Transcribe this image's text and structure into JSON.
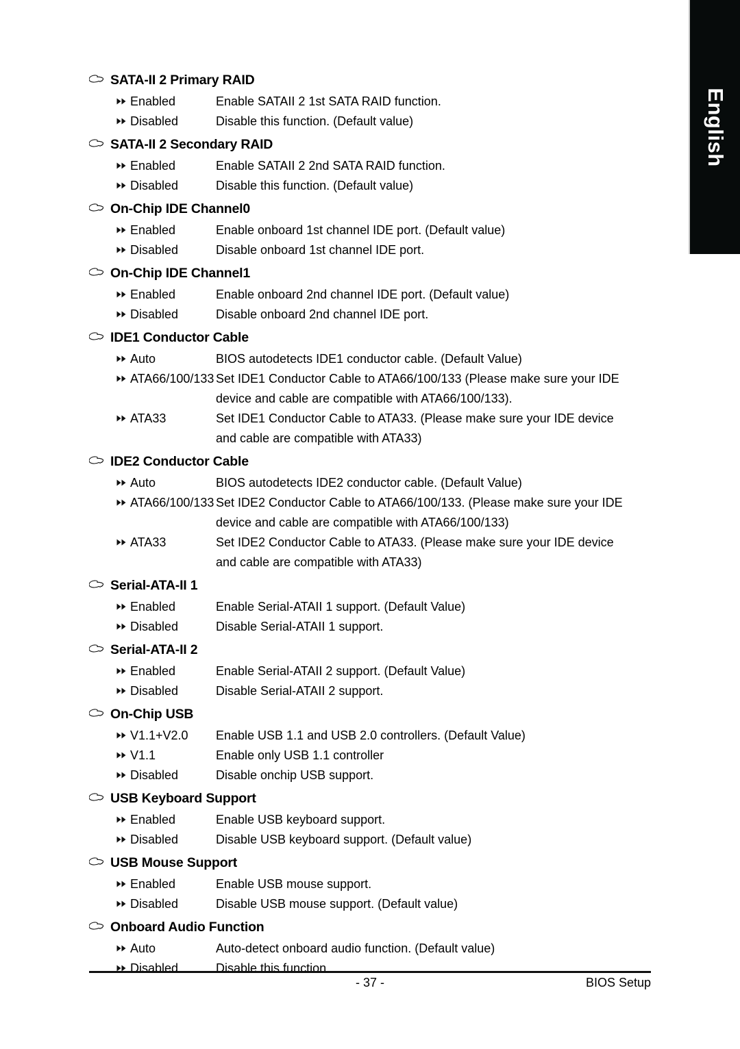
{
  "language_tab": {
    "label": "English"
  },
  "icons": {
    "heading_marker": "pointing-hand-icon",
    "option_marker": "double-triangle-icon"
  },
  "footer": {
    "page_number": "- 37 -",
    "right_label": "BIOS Setup"
  },
  "sections": [
    {
      "title": "SATA-II 2 Primary RAID",
      "options": [
        {
          "label": "Enabled",
          "desc": "Enable SATAII 2 1st SATA RAID function."
        },
        {
          "label": "Disabled",
          "desc": "Disable this function. (Default value)"
        }
      ]
    },
    {
      "title": "SATA-II 2 Secondary RAID",
      "options": [
        {
          "label": "Enabled",
          "desc": "Enable SATAII 2 2nd SATA RAID function."
        },
        {
          "label": "Disabled",
          "desc": "Disable this function. (Default value)"
        }
      ]
    },
    {
      "title": "On-Chip IDE Channel0",
      "options": [
        {
          "label": "Enabled",
          "desc": "Enable onboard 1st channel IDE port. (Default value)"
        },
        {
          "label": "Disabled",
          "desc": "Disable onboard 1st channel IDE port."
        }
      ]
    },
    {
      "title": "On-Chip IDE Channel1",
      "options": [
        {
          "label": "Enabled",
          "desc": "Enable onboard 2nd channel IDE port. (Default value)"
        },
        {
          "label": "Disabled",
          "desc": "Disable onboard 2nd channel IDE port."
        }
      ]
    },
    {
      "title": "IDE1 Conductor Cable",
      "options": [
        {
          "label": "Auto",
          "desc": "BIOS autodetects IDE1 conductor cable. (Default Value)"
        },
        {
          "label": "ATA66/100/133",
          "desc": "Set IDE1 Conductor Cable to ATA66/100/133 (Please make sure your IDE",
          "desc2": "device and cable are compatible with ATA66/100/133)."
        },
        {
          "label": "ATA33",
          "desc": "Set IDE1 Conductor Cable to ATA33. (Please make sure your IDE device",
          "desc2": "and cable are compatible with ATA33)"
        }
      ]
    },
    {
      "title": "IDE2 Conductor Cable",
      "options": [
        {
          "label": "Auto",
          "desc": "BIOS autodetects IDE2 conductor cable. (Default Value)"
        },
        {
          "label": "ATA66/100/133",
          "desc": "Set IDE2 Conductor Cable to ATA66/100/133. (Please make sure your IDE",
          "desc2": "device and cable are compatible with ATA66/100/133)"
        },
        {
          "label": "ATA33",
          "desc": "Set IDE2 Conductor Cable to ATA33. (Please make sure your IDE device",
          "desc2": "and cable are compatible with ATA33)"
        }
      ]
    },
    {
      "title": "Serial-ATA-II 1",
      "options": [
        {
          "label": "Enabled",
          "desc": "Enable Serial-ATAII 1 support. (Default Value)"
        },
        {
          "label": "Disabled",
          "desc": "Disable Serial-ATAII 1 support."
        }
      ]
    },
    {
      "title": "Serial-ATA-II 2",
      "options": [
        {
          "label": "Enabled",
          "desc": "Enable Serial-ATAII 2 support. (Default Value)"
        },
        {
          "label": "Disabled",
          "desc": "Disable Serial-ATAII 2 support."
        }
      ]
    },
    {
      "title": "On-Chip USB",
      "options": [
        {
          "label": "V1.1+V2.0",
          "desc": "Enable USB 1.1 and USB 2.0 controllers. (Default Value)"
        },
        {
          "label": "V1.1",
          "desc": "Enable only USB 1.1 controller"
        },
        {
          "label": "Disabled",
          "desc": "Disable onchip USB support."
        }
      ]
    },
    {
      "title": "USB Keyboard Support",
      "options": [
        {
          "label": "Enabled",
          "desc": "Enable USB keyboard support."
        },
        {
          "label": "Disabled",
          "desc": "Disable USB keyboard support. (Default value)"
        }
      ]
    },
    {
      "title": "USB Mouse Support",
      "options": [
        {
          "label": "Enabled",
          "desc": "Enable USB mouse support."
        },
        {
          "label": "Disabled",
          "desc": "Disable USB mouse support. (Default value)"
        }
      ]
    },
    {
      "title": "Onboard Audio Function",
      "options": [
        {
          "label": "Auto",
          "desc": "Auto-detect onboard audio function. (Default value)"
        },
        {
          "label": "Disabled",
          "desc": "Disable this function."
        }
      ]
    }
  ]
}
